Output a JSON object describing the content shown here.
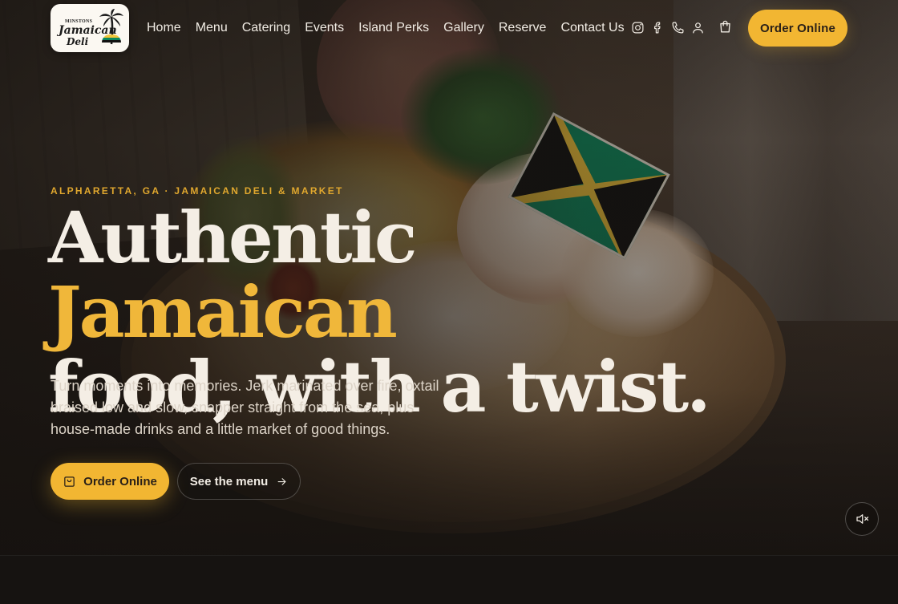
{
  "brand": {
    "logo_small": "MINSTONS",
    "logo_main": "Jamaican",
    "logo_sub": "Deli",
    "accent_color": "#f2b632"
  },
  "nav": {
    "links": [
      "Home",
      "Menu",
      "Catering",
      "Events",
      "Island Perks",
      "Gallery",
      "Reserve",
      "Contact Us"
    ],
    "icons": [
      "instagram-icon",
      "facebook-icon",
      "phone-icon",
      "user-icon",
      "cart-icon"
    ],
    "order_label": "Order Online"
  },
  "hero": {
    "eyebrow": "ALPHARETTA, GA · JAMAICAN DELI & MARKET",
    "headline_pre": "Authentic ",
    "headline_accent": "Jamaican",
    "headline_line2": "food, with a twist.",
    "subcopy": "Turn moments into memories. Jerk marinated over fire, oxtail braised low and slow, snapper straight from the sea, plus house-made drinks and a little market of good things.",
    "cta_primary": "Order Online",
    "cta_secondary": "See the menu",
    "mute_icon": "speaker-muted-icon"
  }
}
